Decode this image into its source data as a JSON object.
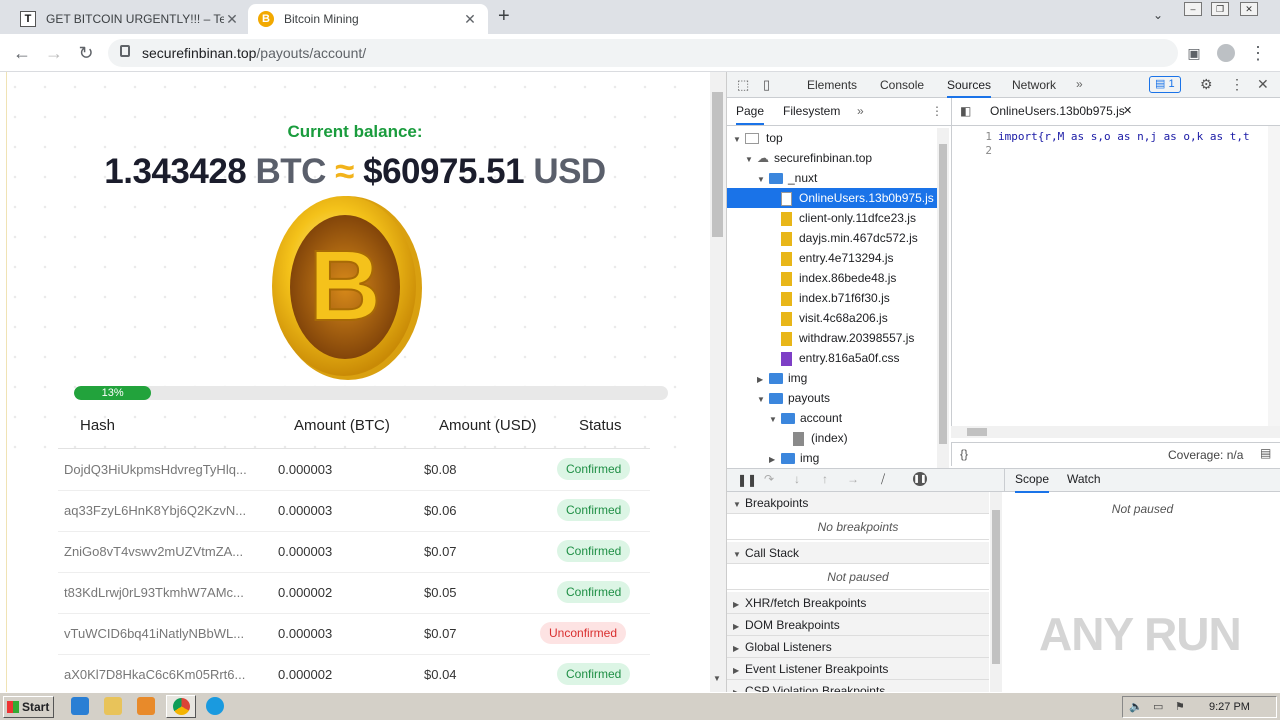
{
  "browser": {
    "tabs": [
      {
        "title": "GET BITCOIN URGENTLY!!! – Telegram",
        "favicon": "T"
      },
      {
        "title": "Bitcoin Mining",
        "favicon": "B"
      }
    ],
    "url_host": "securefinbinan.top",
    "url_path": "/payouts/account/"
  },
  "page": {
    "balance_title": "Current balance:",
    "btc_amount": "1.343428",
    "btc_unit": "BTC",
    "approx": "≈",
    "usd_amount": "$60975.51",
    "usd_unit": "USD",
    "progress": 13,
    "progress_label": "13%",
    "columns": [
      "Hash",
      "Amount (BTC)",
      "Amount (USD)",
      "Status"
    ],
    "rows": [
      {
        "hash": "DojdQ3HiUkpmsHdvregTyHlq...",
        "btc": "0.000003",
        "usd": "$0.08",
        "status": "Confirmed"
      },
      {
        "hash": "aq33FzyL6HnK8Ybj6Q2KzvN...",
        "btc": "0.000003",
        "usd": "$0.06",
        "status": "Confirmed"
      },
      {
        "hash": "ZniGo8vT4vswv2mUZVtmZA...",
        "btc": "0.000003",
        "usd": "$0.07",
        "status": "Confirmed"
      },
      {
        "hash": "t83KdLrwj0rL93TkmhW7AMc...",
        "btc": "0.000002",
        "usd": "$0.05",
        "status": "Confirmed"
      },
      {
        "hash": "vTuWCID6bq41iNatlyNBbWL...",
        "btc": "0.000003",
        "usd": "$0.07",
        "status": "Unconfirmed"
      },
      {
        "hash": "aX0Kl7D8HkaC6c6Km05Rrt6...",
        "btc": "0.000002",
        "usd": "$0.04",
        "status": "Confirmed"
      }
    ]
  },
  "devtools": {
    "tabs": [
      "Elements",
      "Console",
      "Sources",
      "Network"
    ],
    "issues_count": "1",
    "nav_tabs": [
      "Page",
      "Filesystem"
    ],
    "open_file": "OnlineUsers.13b0b975.js",
    "code_line1": "import{r,M as s,o as n,j as o,k as t,t",
    "line_numbers": [
      "1",
      "2"
    ],
    "tree": {
      "top": "top",
      "domain": "securefinbinan.top",
      "nuxt": "_nuxt",
      "files": [
        "OnlineUsers.13b0b975.js",
        "client-only.11dfce23.js",
        "dayjs.min.467dc572.js",
        "entry.4e713294.js",
        "index.86bede48.js",
        "index.b71f6f30.js",
        "visit.4c68a206.js",
        "withdraw.20398557.js",
        "entry.816a5a0f.css"
      ],
      "img": "img",
      "payouts": "payouts",
      "account": "account",
      "index": "(index)",
      "img2": "img"
    },
    "coverage": "Coverage: n/a",
    "sections": {
      "breakpoints": "Breakpoints",
      "no_breakpoints": "No breakpoints",
      "call_stack": "Call Stack",
      "not_paused": "Not paused",
      "xhr": "XHR/fetch Breakpoints",
      "dom": "DOM Breakpoints",
      "global": "Global Listeners",
      "event": "Event Listener Breakpoints",
      "csp": "CSP Violation Breakpoints"
    },
    "scope_tabs": [
      "Scope",
      "Watch"
    ],
    "scope_not_paused": "Not paused"
  },
  "watermark": "ANY RUN",
  "taskbar": {
    "start": "Start",
    "clock": "9:27 PM"
  }
}
